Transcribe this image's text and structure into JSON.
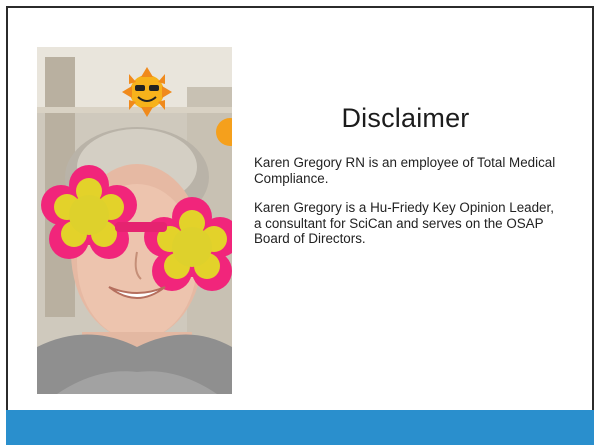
{
  "slide": {
    "title": "Disclaimer",
    "paragraphs": [
      "Karen Gregory RN is an employee of Total Medical Compliance.",
      "Karen Gregory is a Hu-Friedy Key Opinion Leader, a consultant for SciCan and serves  on the OSAP Board of Directors."
    ]
  },
  "colors": {
    "footer_bar": "#2a8fcd",
    "frame": "#2b2b2b",
    "background": "#ffffff"
  }
}
